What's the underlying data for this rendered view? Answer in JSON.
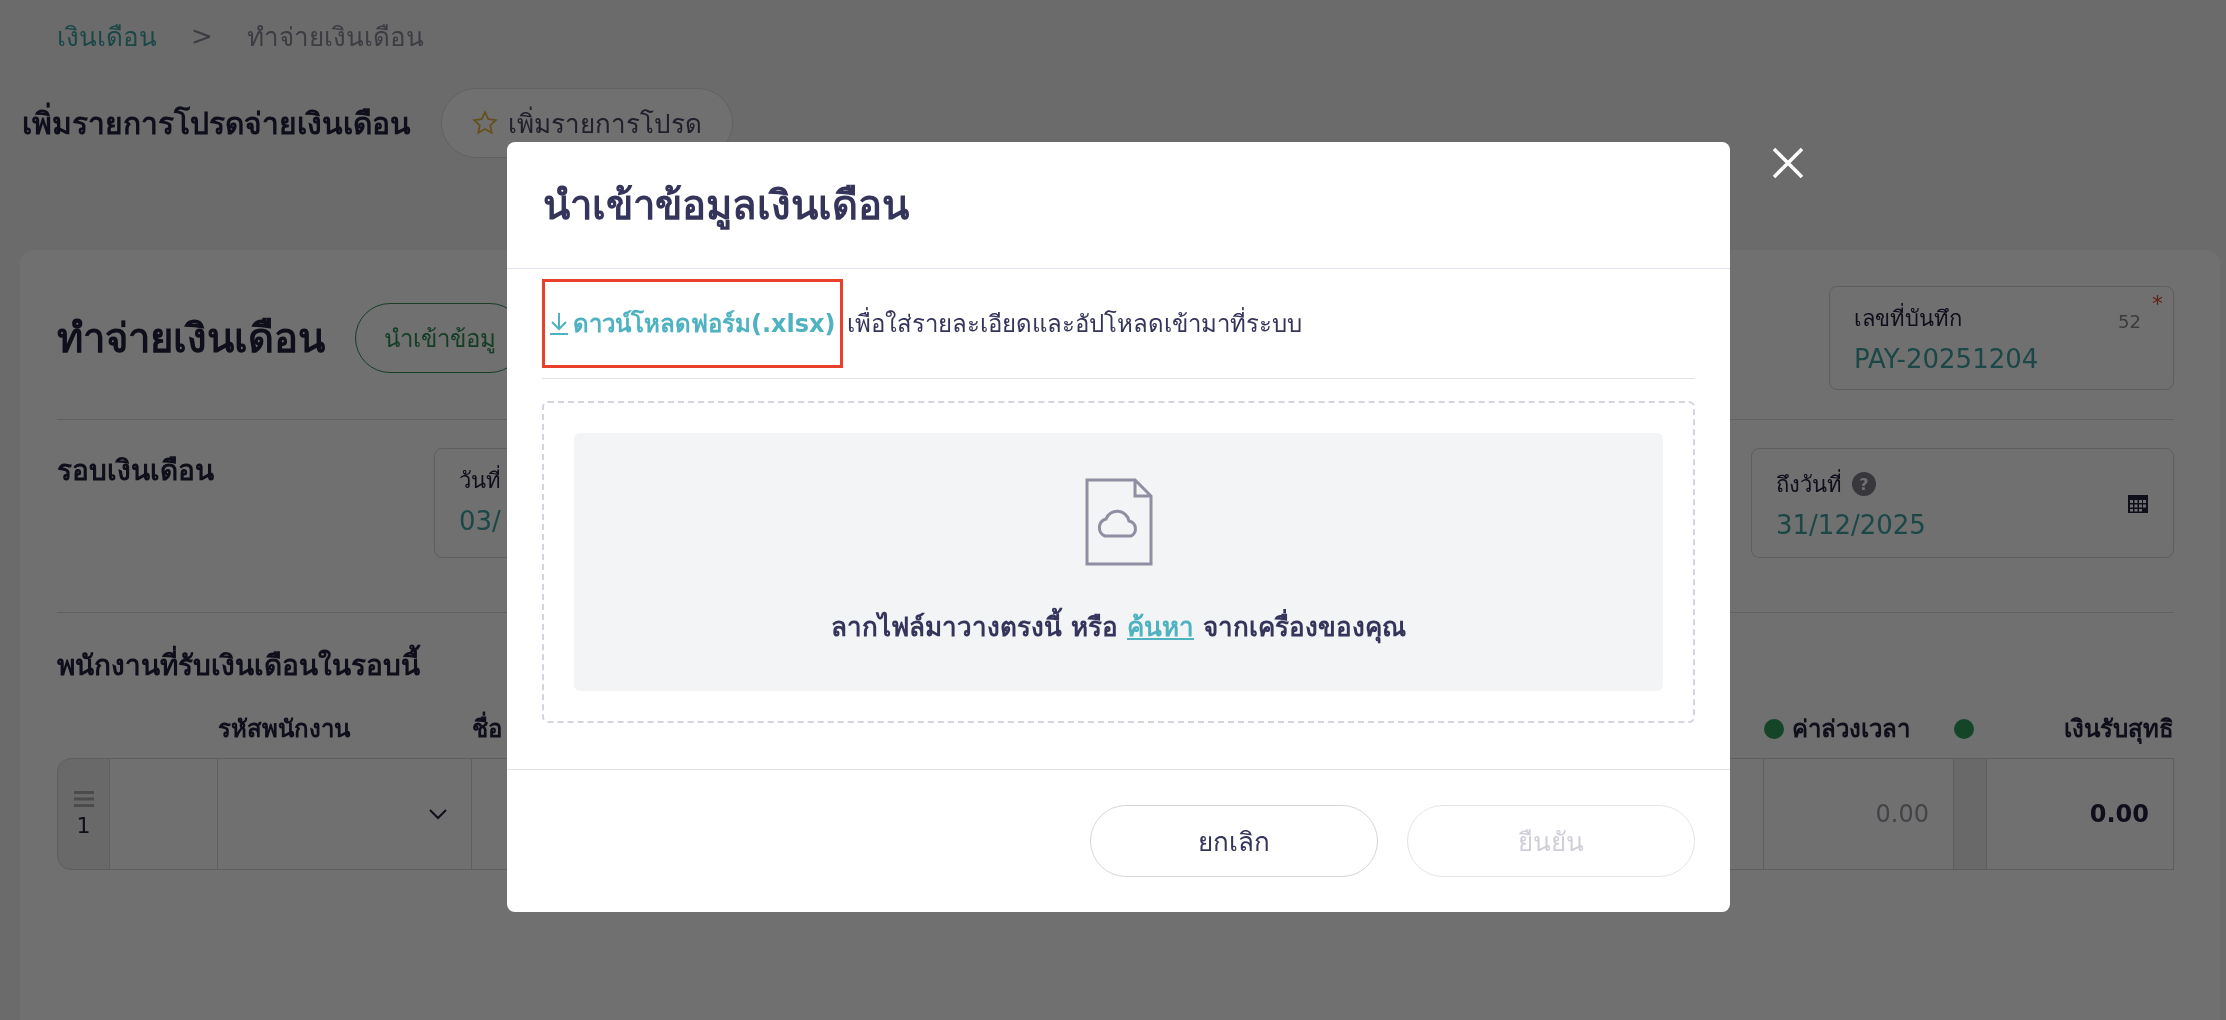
{
  "breadcrumb": [
    {
      "label": "เงินเดือน",
      "kind": "link"
    },
    {
      "label": ">",
      "kind": "separator"
    },
    {
      "label": "ทำจ่ายเงินเดือน",
      "kind": "current"
    }
  ],
  "page_title": "เพิ่มรายการโปรดจ่ายเงินเดือน",
  "favorite_button": {
    "label": "เพิ่มรายการโปรด"
  },
  "card": {
    "title": "ทำจ่ายเงินเดือน",
    "import_button": "นำเข้าข้อมู",
    "record_field": {
      "label": "เลขที่บันทึก",
      "count": "52",
      "required_mark": "*",
      "value": "PAY-20251204"
    },
    "period": {
      "label": "รอบเงินเดือน",
      "from": {
        "label": "วันที่",
        "value": "03/"
      },
      "to": {
        "label": "ถึงวันที่",
        "help": "?",
        "value": "31/12/2025"
      }
    },
    "employees": {
      "title": "พนักงานที่รับเงินเดือนในรอบนี้",
      "columns": [
        {
          "label": "รหัสพนักงาน"
        },
        {
          "label": "ชื่อ"
        },
        {
          "label": "ค่าล่วงเวลา"
        },
        {
          "label": "เงินรับสุทธิ"
        }
      ],
      "rows": [
        {
          "index": "1",
          "overtime": "0.00",
          "net": "0.00"
        }
      ]
    }
  },
  "modal": {
    "title": "นำเข้าข้อมูลเงินเดือน",
    "download_link": {
      "label": "ดาวน์โหลดฟอร์ม(.xlsx)",
      "highlighted": true
    },
    "download_note": "เพื่อใส่รายละเอียดและอัปโหลดเข้ามาที่ระบบ",
    "dropzone": {
      "text_before": "ลากไฟล์มาวางตรงนี้ หรือ",
      "browse_link": "ค้นหา",
      "text_after": "จากเครื่องของคุณ"
    },
    "buttons": [
      {
        "label": "ยกเลิก",
        "disabled": false
      },
      {
        "label": "ยืนยัน",
        "disabled": true
      }
    ]
  }
}
